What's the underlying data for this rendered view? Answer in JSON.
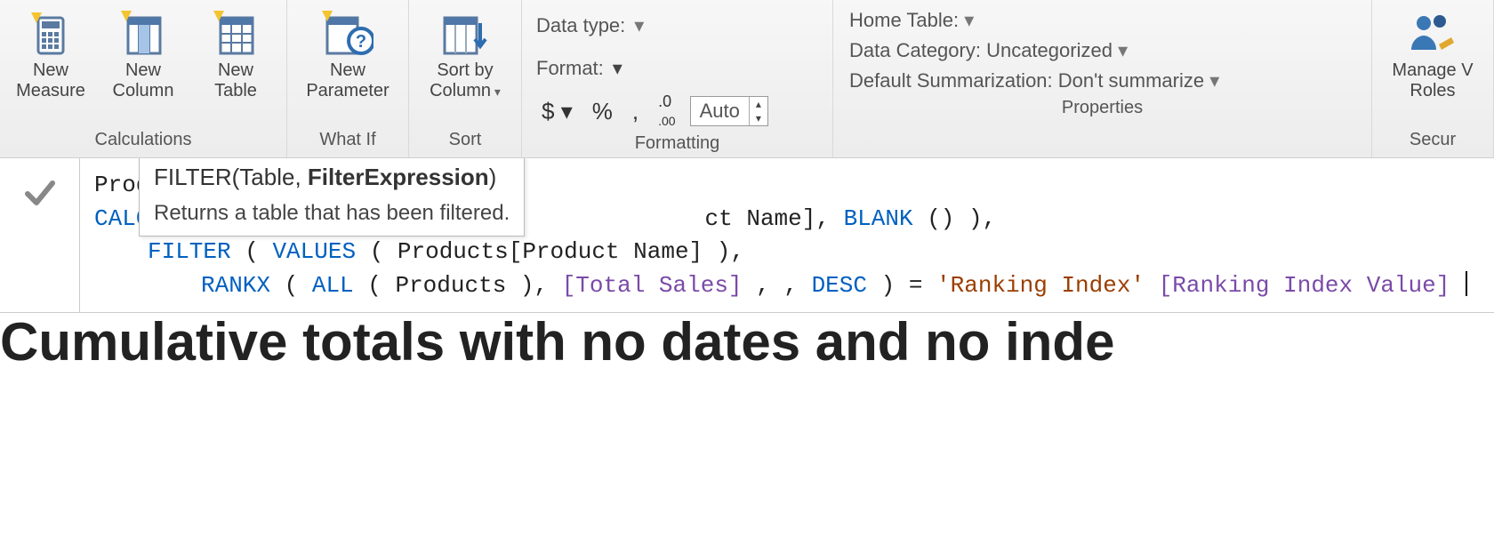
{
  "ribbon": {
    "calculations": {
      "label": "Calculations",
      "new_measure": "New\nMeasure",
      "new_column": "New\nColumn",
      "new_table": "New\nTable"
    },
    "whatif": {
      "label": "What If",
      "new_parameter": "New\nParameter"
    },
    "sort": {
      "label": "Sort",
      "sort_by_column": "Sort by\nColumn"
    },
    "formatting": {
      "label": "Formatting",
      "data_type_label": "Data type:",
      "format_label": "Format:",
      "currency_sym": "$",
      "percent_sym": "%",
      "comma_sym": ",",
      "decimals_sym": ".00",
      "auto": "Auto"
    },
    "properties": {
      "label": "Properties",
      "home_table": "Home Table:",
      "data_category": "Data Category: Uncategorized",
      "default_summarization": "Default Summarization: Don't summarize"
    },
    "security": {
      "label": "Secur",
      "manage_roles": "Manage V\nRoles"
    }
  },
  "tooltip": {
    "signature_pre": "FILTER(Table, ",
    "signature_bold": "FilterExpression",
    "signature_post": ")",
    "description": "Returns a table that has been filtered."
  },
  "formula": {
    "line1_prefix": "Prod",
    "line2_pre": "CALC",
    "line2_tail_black": "ct Name], ",
    "line2_blank": "BLANK",
    "line2_tail2": "() ),",
    "line3_filter": "FILTER",
    "line3_values": "VALUES",
    "line3_mid": "( Products[Product Name] ),",
    "line4_rankx": "RANKX",
    "line4_all": "ALL",
    "line4_p1": "( Products ), ",
    "line4_meas": "[Total Sales]",
    "line4_p2": ", , ",
    "line4_desc": "DESC",
    "line4_p3": " ) = ",
    "line4_str": "'Ranking Index'",
    "line4_col": "[Ranking Index Value]"
  },
  "canvas": {
    "title": "Cumulative totals with no dates and no inde"
  }
}
